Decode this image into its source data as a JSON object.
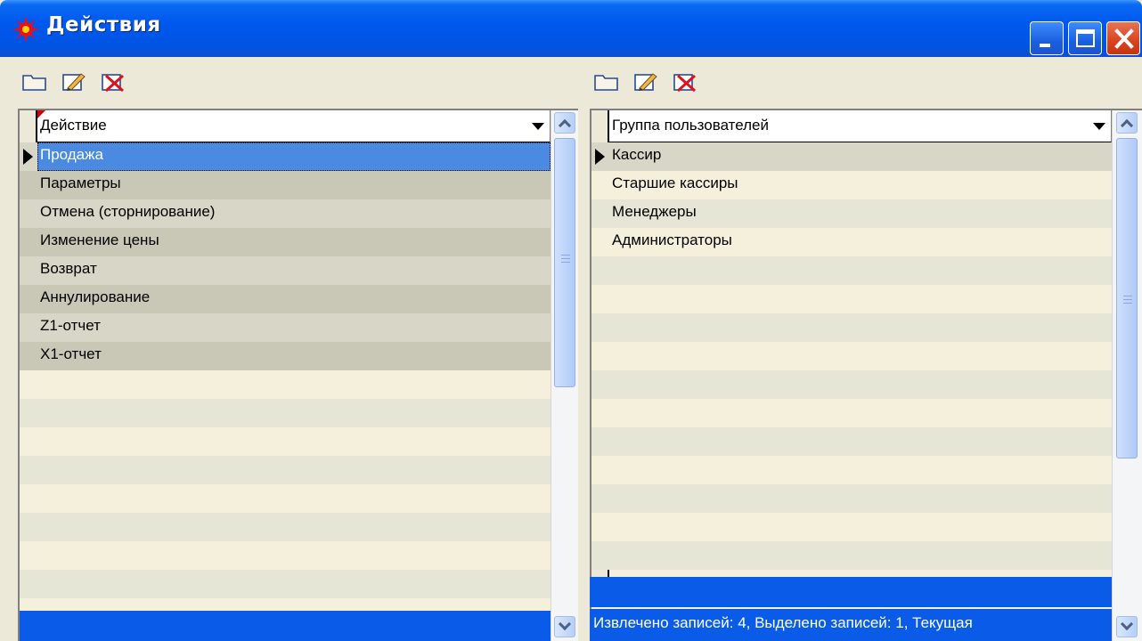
{
  "window": {
    "title": "Действия"
  },
  "left": {
    "header": "Действие",
    "rows": [
      "Продажа",
      "Параметры",
      "Отмена (сторнирование)",
      "Изменение цены",
      "Возврат",
      "Аннулирование",
      "Z1-отчет",
      "X1-отчет"
    ],
    "selected_index": 0
  },
  "right": {
    "header": "Группа пользователей",
    "rows": [
      "Кассир",
      "Старшие кассиры",
      "Менеджеры",
      "Администраторы"
    ],
    "current_index": 0,
    "status": "Извлечено записей: 4, Выделено записей: 1, Текущая"
  },
  "toolbar_icons": [
    "folder-icon",
    "edit-icon",
    "delete-icon"
  ],
  "colors": {
    "titlebar": "#0054e3",
    "selection": "#4a8ae0",
    "footer": "#0a5ce8"
  }
}
